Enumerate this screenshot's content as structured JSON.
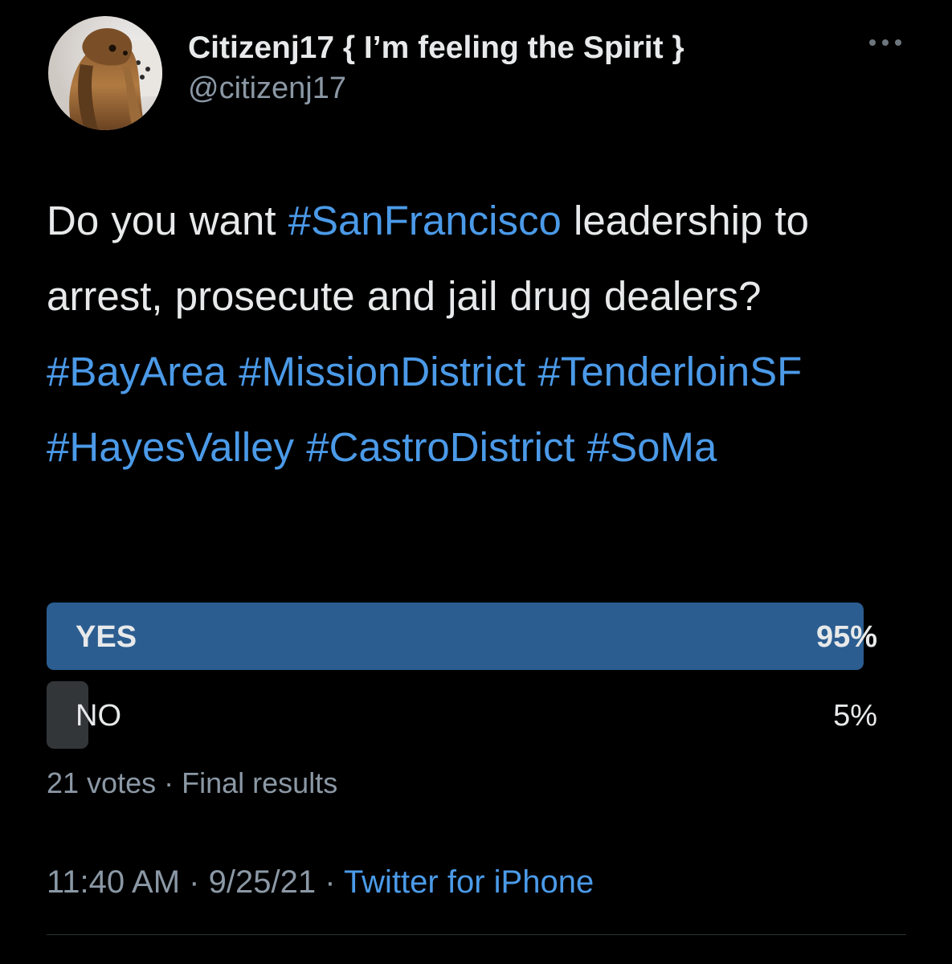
{
  "author": {
    "display_name": "Citizenj17 { I’m feeling the Spirit }",
    "handle": "@citizenj17"
  },
  "tweet": {
    "segments": [
      {
        "text": "Do you want ",
        "type": "plain"
      },
      {
        "text": "#SanFrancisco",
        "type": "hashtag"
      },
      {
        "text": " leadership to arrest, prosecute and jail drug dealers? ",
        "type": "plain"
      },
      {
        "text": "#BayArea",
        "type": "hashtag"
      },
      {
        "text": " ",
        "type": "plain"
      },
      {
        "text": "#MissionDistrict",
        "type": "hashtag"
      },
      {
        "text": " ",
        "type": "plain"
      },
      {
        "text": "#TenderloinSF",
        "type": "hashtag"
      },
      {
        "text": " ",
        "type": "plain"
      },
      {
        "text": "#HayesValley",
        "type": "hashtag"
      },
      {
        "text": " ",
        "type": "plain"
      },
      {
        "text": "#CastroDistrict",
        "type": "hashtag"
      },
      {
        "text": " ",
        "type": "plain"
      },
      {
        "text": "#SoMa",
        "type": "hashtag"
      }
    ]
  },
  "poll": {
    "options": [
      {
        "label": "YES",
        "percent_text": "95%",
        "percent": 95,
        "winner": true
      },
      {
        "label": "NO",
        "percent_text": "5%",
        "percent": 5,
        "winner": false
      }
    ],
    "votes": "21 votes",
    "separator": "·",
    "status": "Final results"
  },
  "meta": {
    "time": "11:40 AM",
    "date": "9/25/21",
    "separator": "·",
    "source": "Twitter for iPhone"
  },
  "colors": {
    "background": "#000000",
    "text": "#e7e9ea",
    "secondary": "#8b98a5",
    "link": "#4b9ae8",
    "poll_winner": "#2b5d90",
    "poll_other": "#333639"
  },
  "icons": {
    "more": "more-horizontal-icon"
  }
}
